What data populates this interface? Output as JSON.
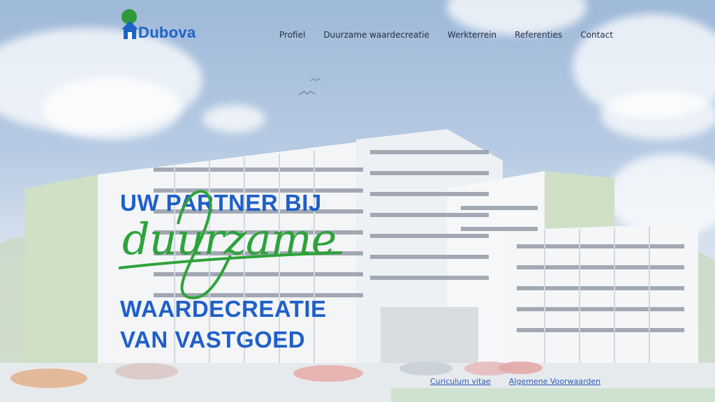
{
  "brand": {
    "name": "Dubova",
    "colors": {
      "blue": "#1f5fc8",
      "green": "#2da33a"
    }
  },
  "nav": {
    "items": [
      {
        "label": "Profiel"
      },
      {
        "label": "Duurzame waardecreatie"
      },
      {
        "label": "Werkterrein"
      },
      {
        "label": "Referenties"
      },
      {
        "label": "Contact"
      }
    ]
  },
  "hero": {
    "line1": "UW PARTNER BIJ",
    "script": "duurzame",
    "line2": "WAARDECREATIE",
    "line3": "VAN VASTGOED"
  },
  "footer": {
    "links": [
      {
        "label": "Curiculum vitae"
      },
      {
        "label": "Algemene Voorwaarden"
      }
    ]
  },
  "background": {
    "image": "building-illustration"
  }
}
